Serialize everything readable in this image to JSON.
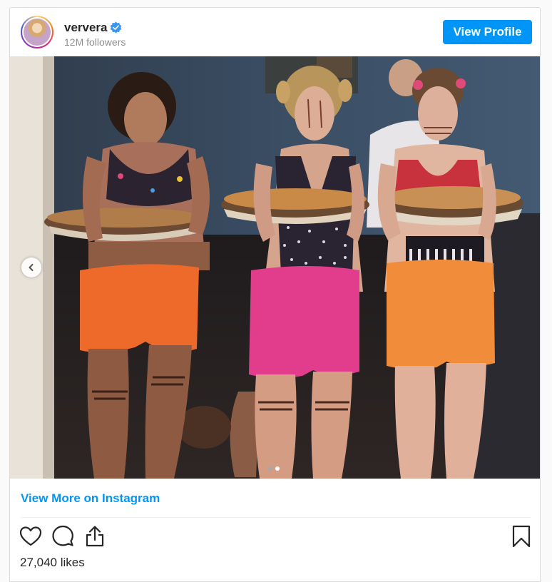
{
  "post": {
    "username": "ververa",
    "followers": "12M followers",
    "view_profile_label": "View Profile",
    "view_more_label": "View More on Instagram",
    "likes": "27,040 likes"
  },
  "carousel": {
    "total_slides": 2,
    "active_slide": 2
  },
  "icons": {
    "verified": "verified-badge-icon",
    "like": "heart-icon",
    "comment": "comment-icon",
    "share": "share-icon",
    "save": "bookmark-icon",
    "prev": "chevron-left-icon"
  },
  "colors": {
    "accent": "#0095f6",
    "text": "#262626",
    "muted": "#8e8e8e",
    "border": "#dbdbdb"
  }
}
